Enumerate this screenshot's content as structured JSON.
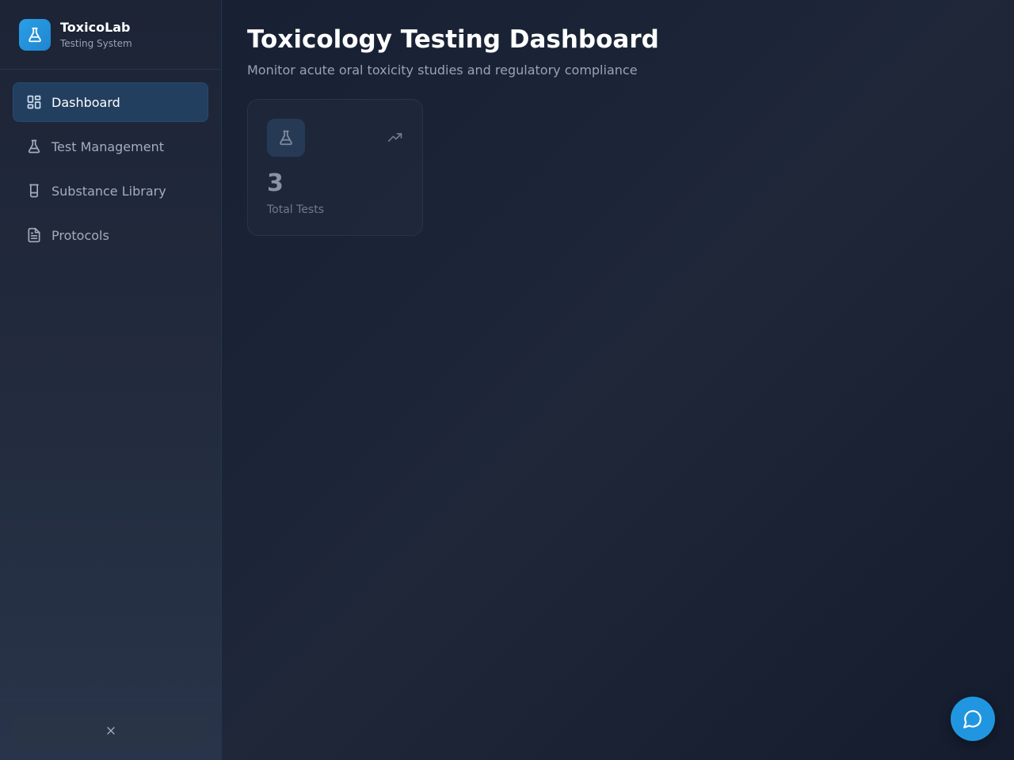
{
  "brand": {
    "name": "ToxicoLab",
    "subtitle": "Testing System",
    "logo_icon": "flask-icon",
    "accent": "#2196e0"
  },
  "sidebar": {
    "items": [
      {
        "label": "Dashboard",
        "icon": "dashboard-grid-icon",
        "active": true
      },
      {
        "label": "Test Management",
        "icon": "flask-icon",
        "active": false
      },
      {
        "label": "Substance Library",
        "icon": "beaker-icon",
        "active": false
      },
      {
        "label": "Protocols",
        "icon": "document-icon",
        "active": false
      }
    ],
    "footer": {
      "icon": "close-icon"
    }
  },
  "main": {
    "title": "Toxicology Testing Dashboard",
    "subtitle": "Monitor acute oral toxicity studies and regulatory compliance",
    "stats": [
      {
        "value": "3",
        "label": "Total Tests",
        "icon": "flask-icon",
        "trend_icon": "trending-up-icon"
      }
    ]
  },
  "chat_button": {
    "icon": "chat-bubble-icon"
  }
}
